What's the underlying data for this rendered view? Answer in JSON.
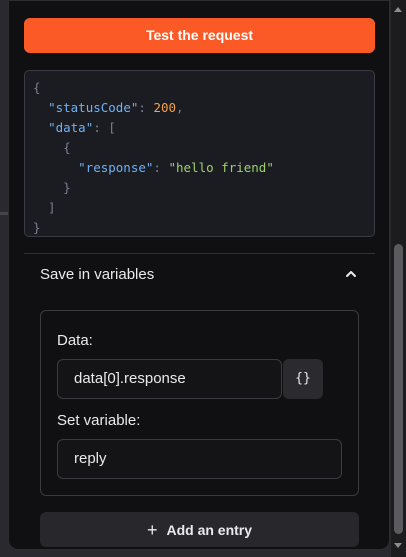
{
  "test_button": {
    "label": "Test the request"
  },
  "response_code": {
    "lines": [
      {
        "tokens": [
          {
            "t": "{",
            "c": "punc"
          }
        ]
      },
      {
        "tokens": [
          {
            "t": "  ",
            "c": "plain"
          },
          {
            "t": "\"statusCode\"",
            "c": "key"
          },
          {
            "t": ": ",
            "c": "punc"
          },
          {
            "t": "200",
            "c": "num"
          },
          {
            "t": ",",
            "c": "punc"
          }
        ]
      },
      {
        "tokens": [
          {
            "t": "  ",
            "c": "plain"
          },
          {
            "t": "\"data\"",
            "c": "key"
          },
          {
            "t": ": [",
            "c": "punc"
          }
        ]
      },
      {
        "tokens": [
          {
            "t": "    {",
            "c": "punc"
          }
        ]
      },
      {
        "tokens": [
          {
            "t": "      ",
            "c": "plain"
          },
          {
            "t": "\"response\"",
            "c": "key"
          },
          {
            "t": ": ",
            "c": "punc"
          },
          {
            "t": "\"hello friend\"",
            "c": "str"
          }
        ]
      },
      {
        "tokens": [
          {
            "t": "    }",
            "c": "punc"
          }
        ]
      },
      {
        "tokens": [
          {
            "t": "  ]",
            "c": "punc"
          }
        ]
      },
      {
        "tokens": [
          {
            "t": "}",
            "c": "punc"
          }
        ]
      }
    ]
  },
  "save_variables": {
    "title": "Save in variables",
    "expanded": true,
    "entry": {
      "data_label": "Data:",
      "data_value": "data[0].response",
      "brace_button": "{}",
      "variable_label": "Set variable:",
      "variable_value": "reply"
    },
    "add_entry_label": "Add an entry"
  },
  "colors": {
    "accent": "#fb5a27",
    "panel": "#101012",
    "code_bg": "#1b1c22",
    "key": "#6fb1f4",
    "number": "#f3a047",
    "string": "#9cd06b"
  }
}
